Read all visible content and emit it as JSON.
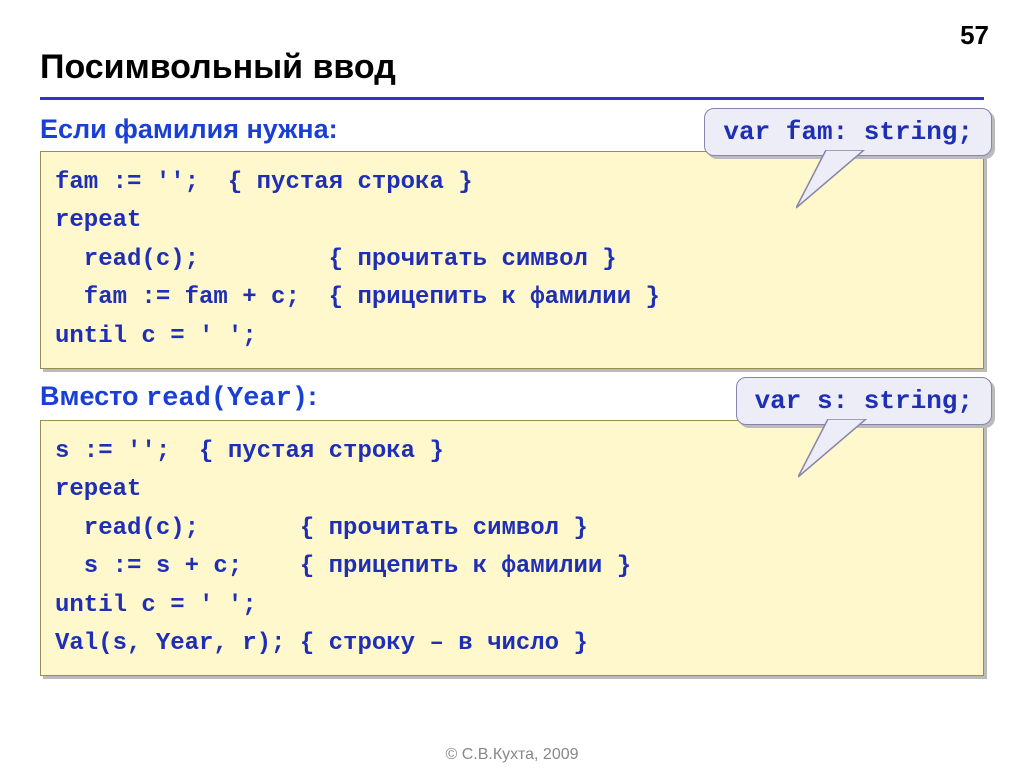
{
  "page_number": "57",
  "title": "Посимвольный ввод",
  "section1": {
    "label": "Если фамилия нужна:",
    "callout": "var fam: string;",
    "code": "fam := '';  { пустая строка }\nrepeat\n  read(c);         { прочитать символ }\n  fam := fam + c;  { прицепить к фамилии }\nuntil c = ' ';"
  },
  "section2": {
    "label_prefix": "Вместо ",
    "label_code": "read(Year)",
    "label_suffix": ":",
    "callout": "var s: string;",
    "code": "s := '';  { пустая строка }\nrepeat\n  read(c);       { прочитать символ }\n  s := s + c;    { прицепить к фамилии }\nuntil c = ' ';\nVal(s, Year, r); { строку – в число }"
  },
  "footer": "© С.В.Кухта, 2009"
}
